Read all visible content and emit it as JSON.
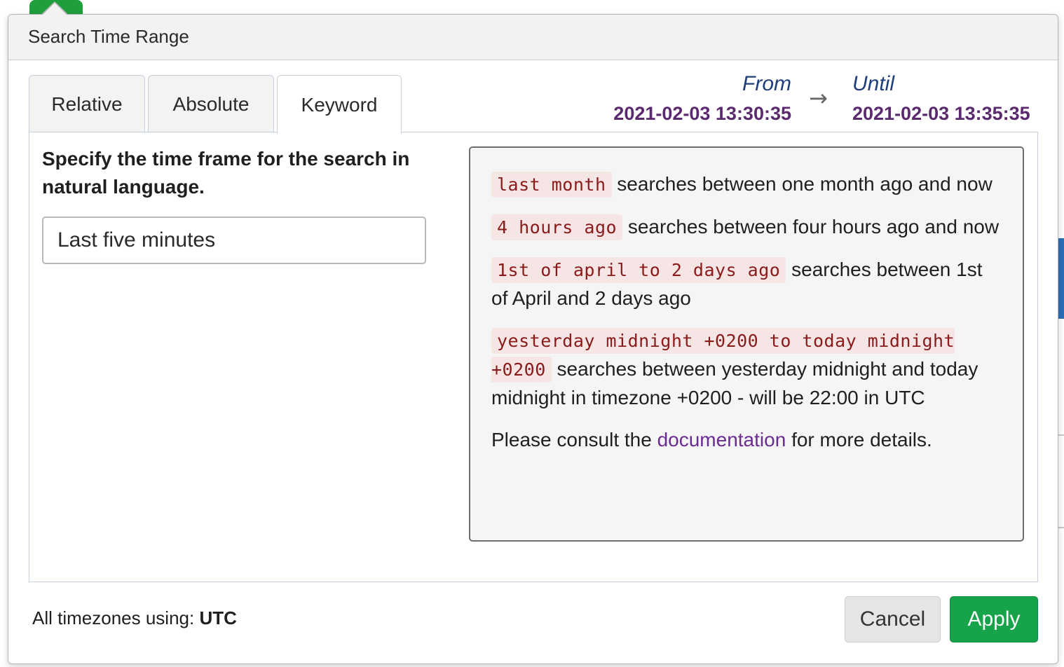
{
  "popover": {
    "title": "Search Time Range"
  },
  "tabs": [
    {
      "label": "Relative"
    },
    {
      "label": "Absolute"
    },
    {
      "label": "Keyword"
    }
  ],
  "active_tab": "Keyword",
  "range": {
    "from_label": "From",
    "from_value": "2021-02-03 13:30:35",
    "arrow": "→",
    "until_label": "Until",
    "until_value": "2021-02-03 13:35:35"
  },
  "keyword": {
    "instructions": "Specify the time frame for the search in natural language.",
    "input_value": "Last five minutes"
  },
  "help": {
    "items": [
      {
        "keyword": "last month",
        "description": "searches between one month ago and now"
      },
      {
        "keyword": "4 hours ago",
        "description": "searches between four hours ago and now"
      },
      {
        "keyword": "1st of april to 2 days ago",
        "description": "searches between 1st of April and 2 days ago"
      },
      {
        "keyword": "yesterday midnight +0200 to today midnight +0200",
        "description": "searches between yesterday midnight and today midnight in timezone +0200 - will be 22:00 in UTC"
      }
    ],
    "consult_prefix": "Please consult the",
    "consult_link": "documentation",
    "consult_suffix": "for more details."
  },
  "footer": {
    "timezone_prefix": "All timezones using:",
    "timezone_value": "UTC",
    "cancel_label": "Cancel",
    "apply_label": "Apply"
  },
  "colors": {
    "apply_button": "#16a34a",
    "range_value": "#5b2a6e",
    "range_label": "#1f3f7a",
    "keyword_code": "#8b1a1a",
    "link": "#6a2c91"
  }
}
